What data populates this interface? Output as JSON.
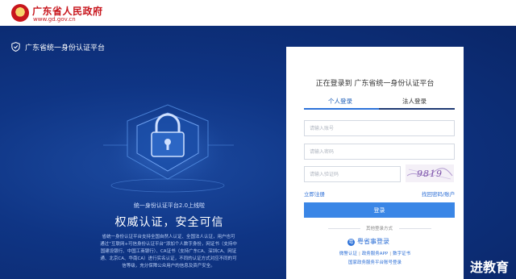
{
  "header": {
    "gov_name": "广东省人民政府",
    "gov_url": "www.gd.gov.cn",
    "emblem_icon": "national-emblem-icon"
  },
  "platform": {
    "title": "广东省统一身份认证平台",
    "icon": "shield-check-icon"
  },
  "hero": {
    "notice": "统一身份认证平台2.0上线啦",
    "slogan": "权威认证，安全可信",
    "description": "省统一身份认证平台支持全国自然人认证、全国法人认证，用户也可通过“互联网+可信身份认证平台”添加个人数字身份，网证书（支持中国建设银行、中国工商银行）、CA证书（支持广东CA、深圳CA、网证通、北京CA、华南CA）进行实名认证，不同的认证方式对应不同的可信等级，充分保障公众用户的信息及资产安全。"
  },
  "login": {
    "title": "正在登录到 广东省统一身份认证平台",
    "tabs": [
      {
        "label": "个人登录",
        "active": true
      },
      {
        "label": "法人登录",
        "active": false
      }
    ],
    "account_placeholder": "请输入账号",
    "password_placeholder": "请输入密码",
    "captcha_placeholder": "请输入验证码",
    "captcha_text": "9819",
    "register_link": "立即注册",
    "forgot_link": "找回密码/账户",
    "login_button": "登录",
    "other_methods": "其他登录方式",
    "yue_login": "粤省事登录",
    "sub_links": [
      "微警认证",
      "政务服务APP",
      "数字证书"
    ],
    "national_link": "国家政务服务平台账号登录"
  },
  "watermark": "进教育",
  "colors": {
    "brand_red": "#c8161d",
    "stage_blue": "#0f3585",
    "accent_blue": "#2d72d9",
    "button_blue": "#3a86e6"
  }
}
